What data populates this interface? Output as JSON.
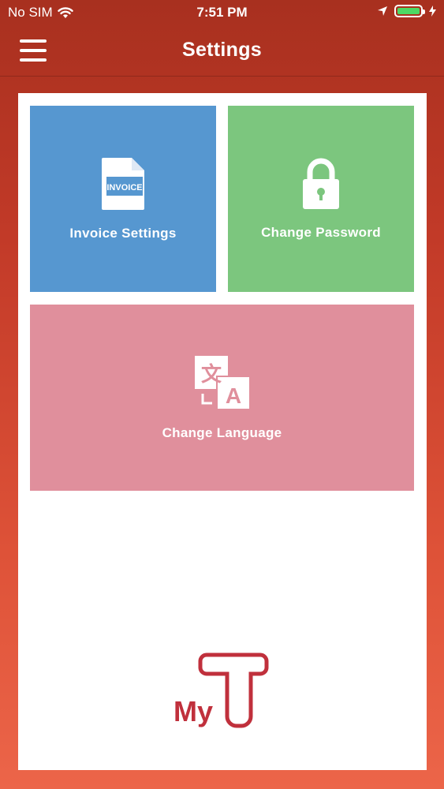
{
  "status_bar": {
    "carrier": "No SIM",
    "time": "7:51 PM"
  },
  "navbar": {
    "title": "Settings"
  },
  "tiles": [
    {
      "label": "Invoice Settings",
      "icon": "invoice-icon",
      "icon_text": "INVOICE",
      "color": "#5697d0"
    },
    {
      "label": "Change Password",
      "icon": "lock-icon",
      "color": "#7cc67e"
    },
    {
      "label": "Change Language",
      "icon": "translate-icon",
      "color": "#e08f9c"
    }
  ],
  "logo": {
    "text": "My",
    "color": "#c0303c"
  }
}
